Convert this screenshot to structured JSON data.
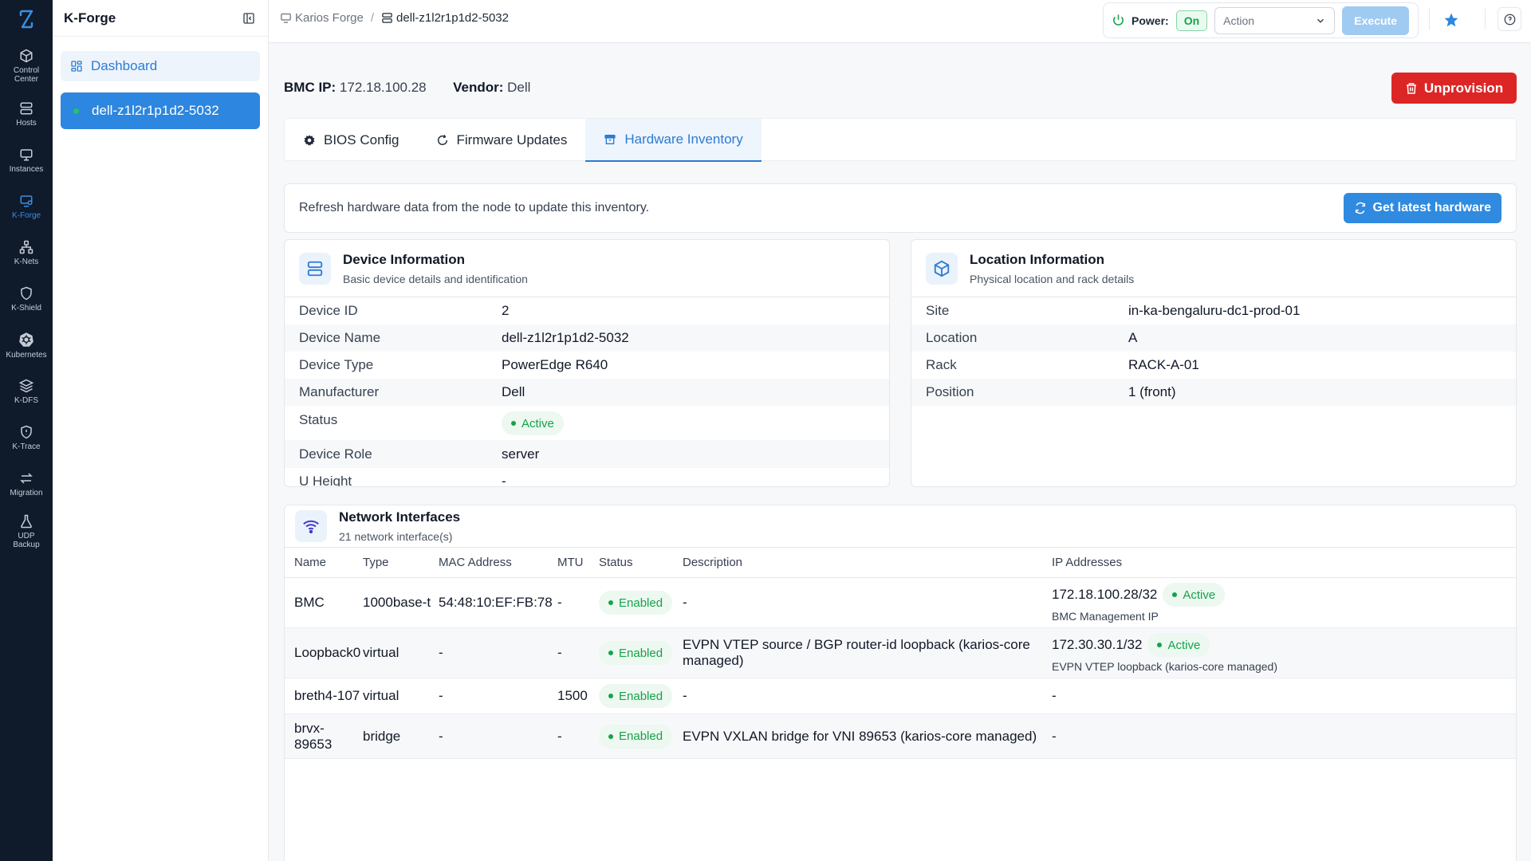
{
  "rail": {
    "items": [
      {
        "label": "Control\nCenter",
        "icon": "cube-icon"
      },
      {
        "label": "Hosts",
        "icon": "server-icon"
      },
      {
        "label": "Instances",
        "icon": "monitor-icon"
      },
      {
        "label": "K-Forge",
        "icon": "forge-icon"
      },
      {
        "label": "K-Nets",
        "icon": "network-icon"
      },
      {
        "label": "K-Shield",
        "icon": "shield-icon"
      },
      {
        "label": "Kubernetes",
        "icon": "kubernetes-icon"
      },
      {
        "label": "K-DFS",
        "icon": "layers-icon"
      },
      {
        "label": "K-Trace",
        "icon": "shield-alert-icon"
      },
      {
        "label": "Migration",
        "icon": "arrows-icon"
      },
      {
        "label": "UDP\nBackup",
        "icon": "flask-icon"
      }
    ]
  },
  "sidebar": {
    "title": "K-Forge",
    "dashboard_label": "Dashboard",
    "host_label": "dell-z1l2r1p1d2-5032"
  },
  "topbar": {
    "breadcrumb_root": "Karios Forge",
    "breadcrumb_sep": "/",
    "breadcrumb_current": "dell-z1l2r1p1d2-5032",
    "power_label": "Power:",
    "power_state": "On",
    "action_placeholder": "Action",
    "execute_label": "Execute"
  },
  "header": {
    "bmc_label": "BMC IP:",
    "bmc_value": "172.18.100.28",
    "vendor_label": "Vendor:",
    "vendor_value": "Dell",
    "unprovision_label": "Unprovision"
  },
  "tabs": [
    {
      "label": "BIOS Config"
    },
    {
      "label": "Firmware Updates"
    },
    {
      "label": "Hardware Inventory"
    }
  ],
  "refresh": {
    "text": "Refresh hardware data from the node to update this inventory.",
    "button_label": "Get latest hardware"
  },
  "device_card": {
    "title": "Device Information",
    "subtitle": "Basic device details and identification",
    "rows": [
      {
        "key": "Device ID",
        "value": "2"
      },
      {
        "key": "Device Name",
        "value": "dell-z1l2r1p1d2-5032"
      },
      {
        "key": "Device Type",
        "value": "PowerEdge R640"
      },
      {
        "key": "Manufacturer",
        "value": "Dell"
      },
      {
        "key": "Status",
        "value": "Active"
      },
      {
        "key": "Device Role",
        "value": "server"
      },
      {
        "key": "U Height",
        "value": "-"
      }
    ]
  },
  "location_card": {
    "title": "Location Information",
    "subtitle": "Physical location and rack details",
    "rows": [
      {
        "key": "Site",
        "value": "in-ka-bengaluru-dc1-prod-01"
      },
      {
        "key": "Location",
        "value": "A"
      },
      {
        "key": "Rack",
        "value": "RACK-A-01"
      },
      {
        "key": "Position",
        "value": "1 (front)"
      }
    ]
  },
  "network": {
    "title": "Network Interfaces",
    "subtitle": "21 network interface(s)",
    "columns": [
      "Name",
      "Type",
      "MAC Address",
      "MTU",
      "Status",
      "Description",
      "IP Addresses"
    ],
    "rows": [
      {
        "name": "BMC",
        "type": "1000base-t",
        "mac": "54:48:10:EF:FB:78",
        "mtu": "-",
        "status": "Enabled",
        "description": "-",
        "ip": "172.18.100.28/32",
        "ip_status": "Active",
        "ip_note": "BMC Management IP"
      },
      {
        "name": "Loopback0",
        "type": "virtual",
        "mac": "-",
        "mtu": "-",
        "status": "Enabled",
        "description": "EVPN VTEP source / BGP router-id loopback (karios-core managed)",
        "ip": "172.30.30.1/32",
        "ip_status": "Active",
        "ip_note": "EVPN VTEP loopback (karios-core managed)"
      },
      {
        "name": "breth4-107",
        "type": "virtual",
        "mac": "-",
        "mtu": "1500",
        "status": "Enabled",
        "description": "-",
        "ip": "-"
      },
      {
        "name": "brvx-\n89653",
        "type": "bridge",
        "mac": "-",
        "mtu": "-",
        "status": "Enabled",
        "description": "EVPN VXLAN bridge for VNI 89653 (karios-core managed)",
        "ip": "-"
      }
    ]
  },
  "colors": {
    "accent": "#2d86df",
    "danger": "#dc2626",
    "success": "#16a34a",
    "rail_bg": "#0f1a2b"
  }
}
